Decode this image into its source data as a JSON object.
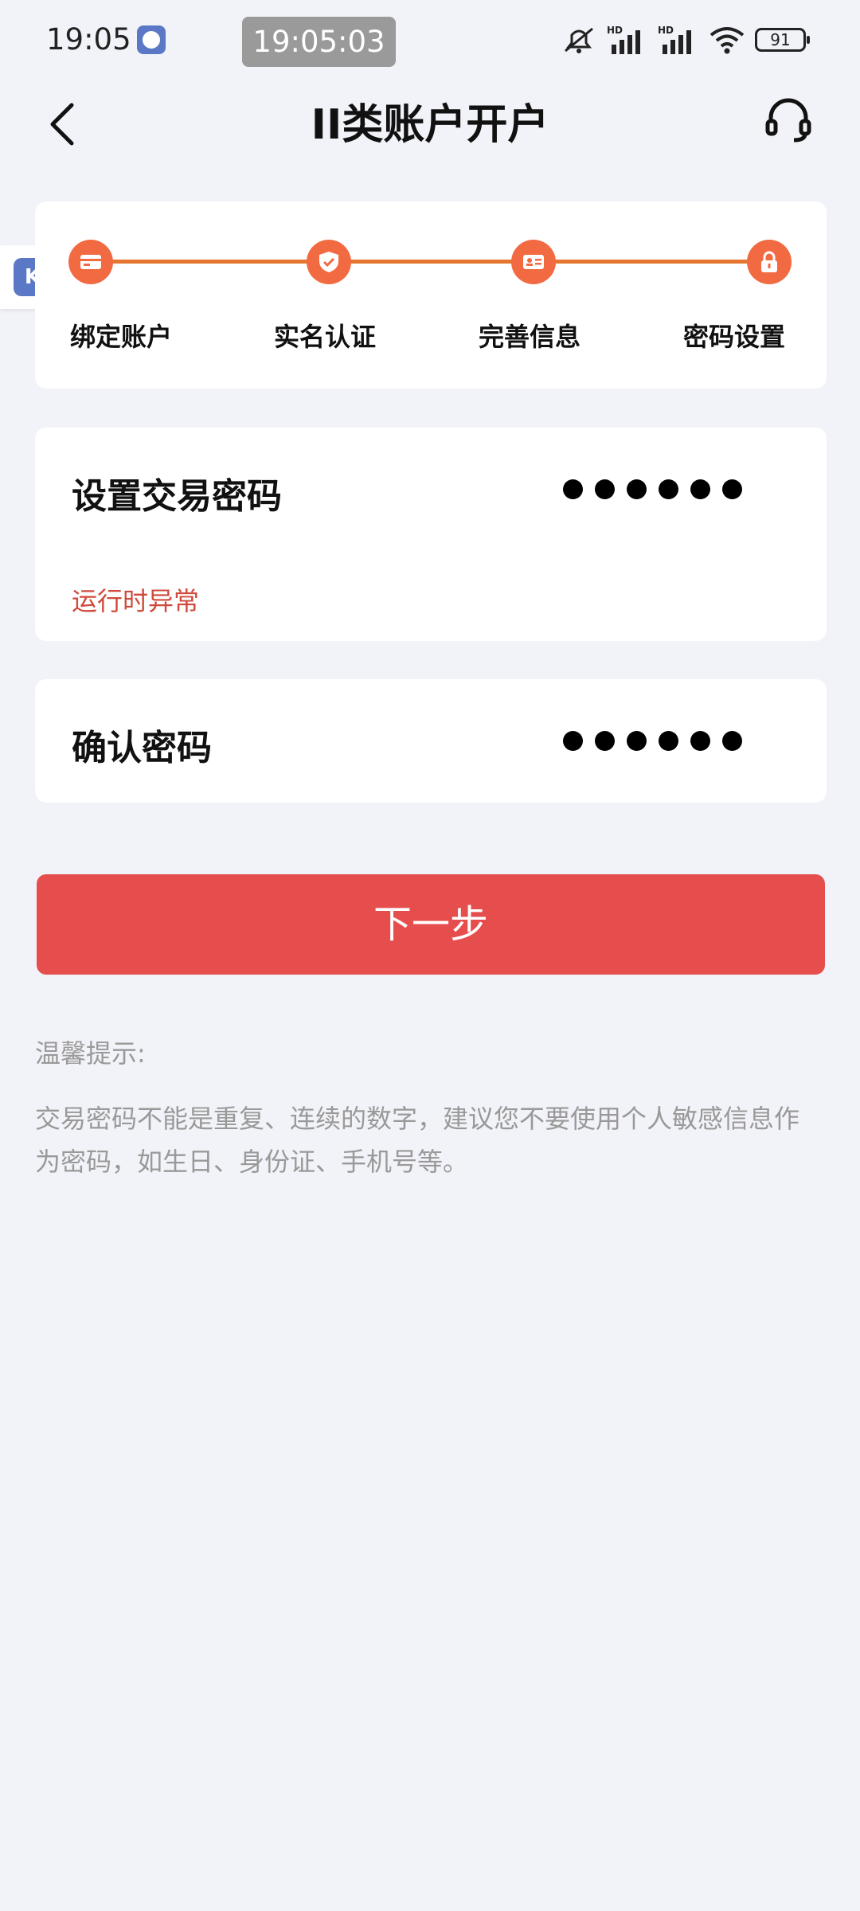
{
  "status_bar": {
    "time": "19:05",
    "clock_pill": "19:05:03",
    "battery": "91",
    "icons": [
      "app-icon",
      "mute-icon",
      "signal-hd-icon",
      "signal-hd-icon",
      "wifi-icon",
      "battery-icon"
    ]
  },
  "header": {
    "title": "II类账户开户",
    "back_icon": "chevron-left-icon",
    "service_icon": "headset-icon"
  },
  "steps": [
    {
      "label": "绑定账户",
      "icon": "card-icon"
    },
    {
      "label": "实名认证",
      "icon": "shield-check-icon"
    },
    {
      "label": "完善信息",
      "icon": "id-card-icon"
    },
    {
      "label": "密码设置",
      "icon": "lock-icon"
    }
  ],
  "password_field": {
    "label": "设置交易密码",
    "error": "运行时异常"
  },
  "confirm_field": {
    "label": "确认密码"
  },
  "next_button": "下一步",
  "tips": {
    "title": "温馨提示:",
    "body": "交易密码不能是重复、连续的数字，建议您不要使用个人敏感信息作为密码，如生日、身份证、手机号等。"
  },
  "colors": {
    "accent": "#e54e4d",
    "step": "#f26a42",
    "error": "#d04a3c",
    "background": "#f2f3f8"
  }
}
